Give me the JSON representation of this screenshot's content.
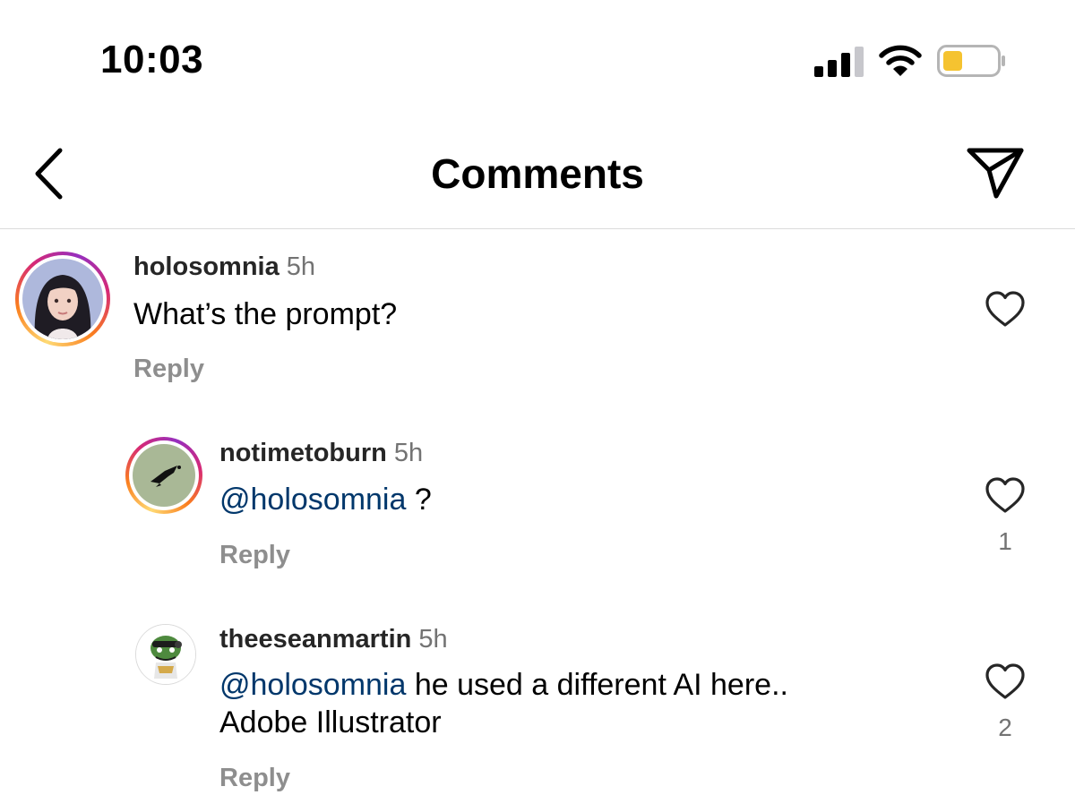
{
  "status_bar": {
    "time": "10:03"
  },
  "header": {
    "title": "Comments"
  },
  "comments": [
    {
      "username": "holosomnia",
      "time": "5h",
      "text": "What’s the prompt?",
      "reply_label": "Reply",
      "likes": ""
    },
    {
      "username": "notimetoburn",
      "time": "5h",
      "mention": "@holosomnia",
      "text": " ?",
      "reply_label": "Reply",
      "likes": "1"
    },
    {
      "username": "theeseanmartin",
      "time": "5h",
      "mention": "@holosomnia",
      "text": " he used a different AI here..",
      "text_line2": "Adobe Illustrator",
      "reply_label": "Reply",
      "likes": "2"
    }
  ],
  "colors": {
    "mention": "#00376b",
    "secondary_text": "#737373",
    "reply_text": "#8e8e8e",
    "divider": "#dbdbdb",
    "battery_fill": "#f5c330"
  },
  "icons": [
    "signal-icon",
    "wifi-icon",
    "battery-icon",
    "back-icon",
    "send-icon",
    "heart-icon"
  ]
}
